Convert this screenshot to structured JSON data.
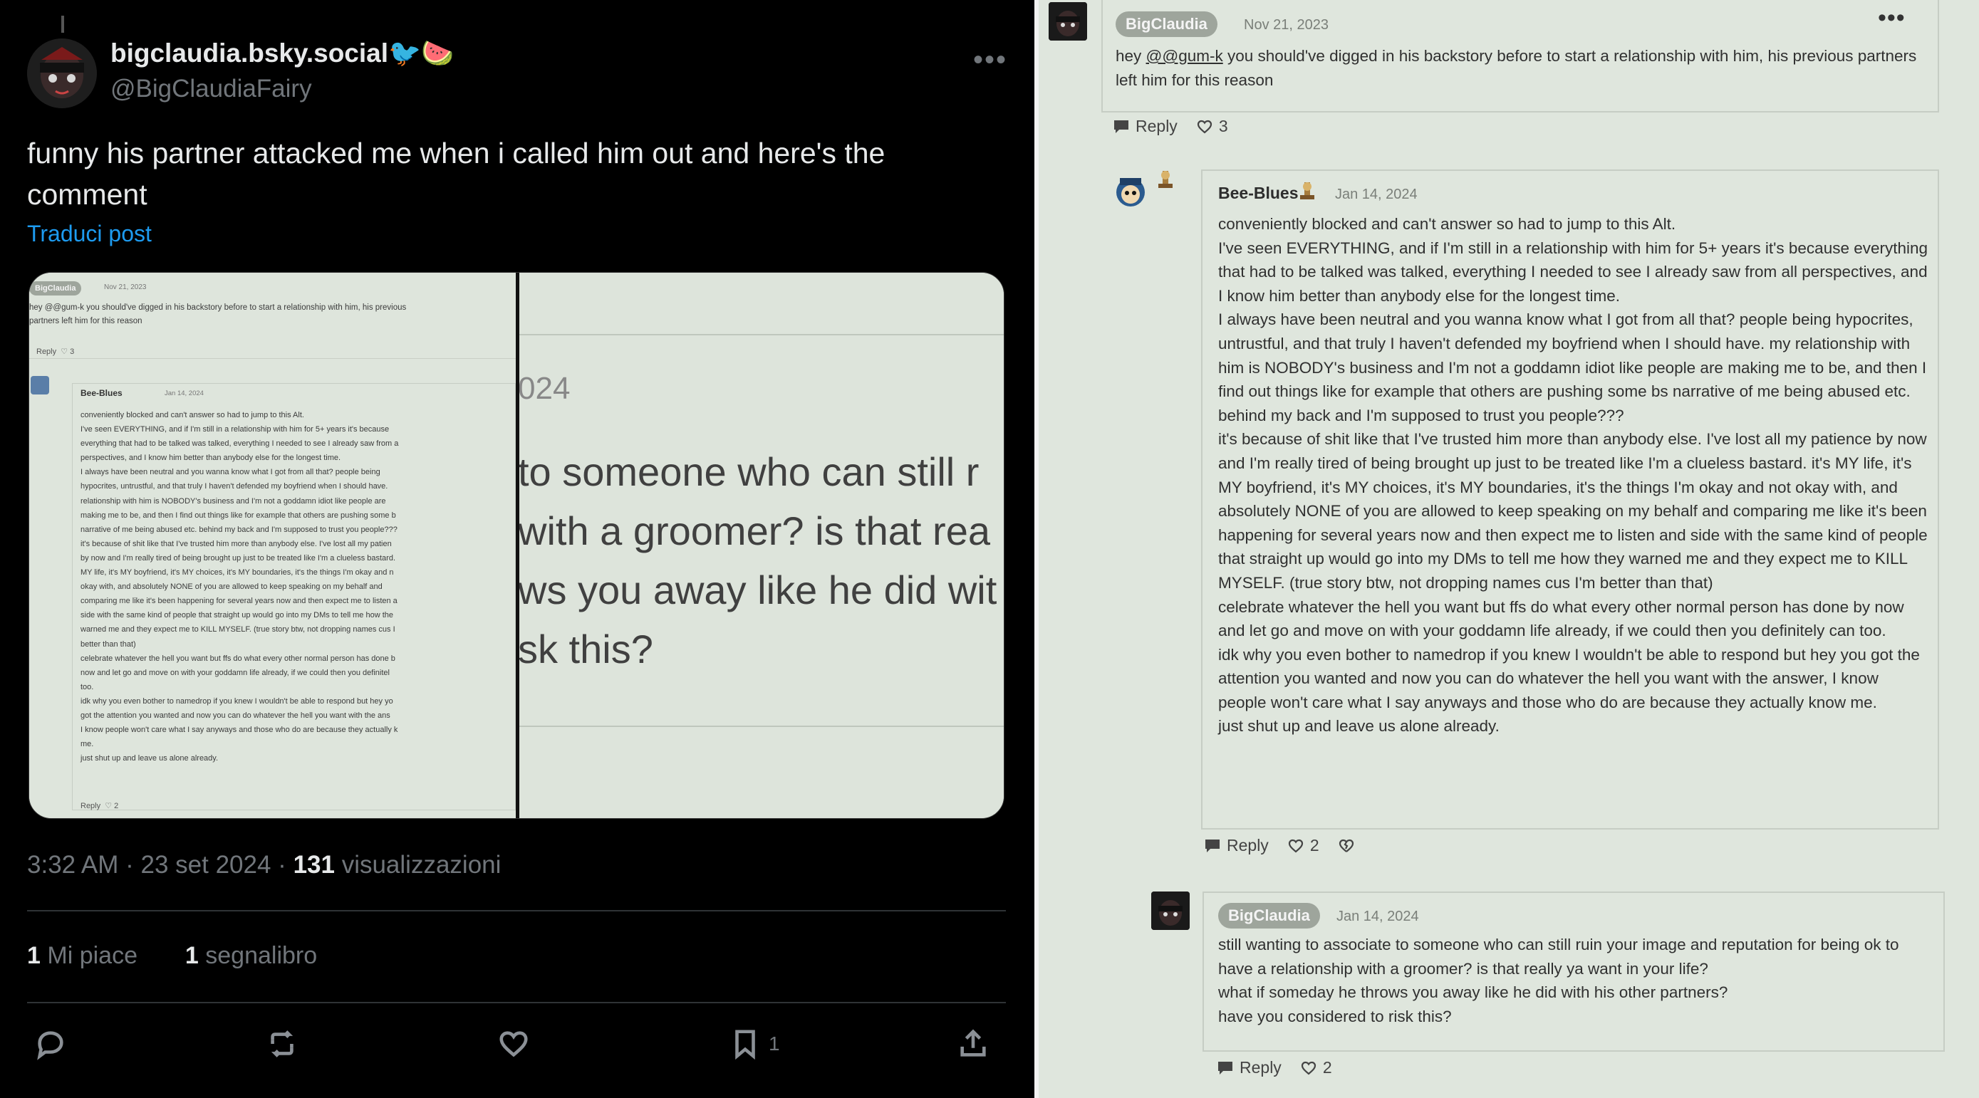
{
  "tweet": {
    "display_name": "bigclaudia.bsky.social🐦🍉",
    "handle": "@BigClaudiaFairy",
    "text": "funny his partner attacked me when i called him out and here's the comment",
    "translate_label": "Traduci post",
    "time": "3:32 AM · 23 set 2024 · ",
    "views_count": "131",
    "views_label": " visualizzazioni",
    "likes_count": "1",
    "likes_label": " Mi piace",
    "bookmarks_count": "1",
    "bookmarks_label": " segnalibro",
    "bookmark_action_count": "1",
    "icons": [
      "more-icon",
      "reply-icon",
      "retweet-icon",
      "like-icon",
      "bookmark-icon",
      "share-icon"
    ],
    "media": {
      "left_panel": {
        "user": "BigClaudia",
        "date": "Nov 21, 2023",
        "comment1_lines": [
          "hey @@gum-k you should've digged in his backstory before to start a relationship with him, his previous",
          "partners left him for this reason"
        ],
        "reply": "Reply",
        "likes": "3",
        "user2": "Bee-Blues",
        "date2": "Jan 14, 2024",
        "comment2_lines": [
          "conveniently blocked and can't answer so had to jump to this Alt.",
          "I've seen EVERYTHING, and if I'm still in a relationship with him for 5+ years it's because",
          "everything that had to be talked was talked, everything I needed to see I already saw from a",
          "perspectives, and I know him better than anybody else for the longest time.",
          "I always have been neutral and you wanna know what I got from all that? people being",
          "hypocrites, untrustful, and that truly I haven't defended my boyfriend when I should have.",
          "relationship with him is NOBODY's business and I'm not a goddamn idiot like people are",
          "making me to be, and then I find out things like for example that others are pushing some b",
          "narrative of me being abused etc. behind my back and I'm supposed to trust you people???",
          "it's because of shit like that I've trusted him more than anybody else. I've lost all my patien",
          "by now and I'm really tired of being brought up just to be treated like I'm a clueless bastard.",
          "MY life, it's MY boyfriend, it's MY choices, it's MY boundaries, it's the things I'm okay and n",
          "okay with, and absolutely NONE of you are allowed to keep speaking on my behalf and",
          "comparing me like it's been happening for several years now and then expect me to listen a",
          "side with the same kind of people that straight up would go into my DMs to tell me how the",
          "warned me and they expect me to KILL MYSELF. (true story btw, not dropping names cus I",
          "better than that)",
          "celebrate whatever the hell you want but ffs do what every other normal person has done b",
          "now and let go and move on with your goddamn life already, if we could then you definitel",
          "too.",
          "idk why you even bother to namedrop if you knew I wouldn't be able to respond but hey yo",
          "got the attention you wanted and now you can do whatever the hell you want with the ans",
          "I know people won't care what I say anyways and those who do are because they actually k",
          "me.",
          "just shut up and leave us alone already."
        ],
        "likes2": "2"
      },
      "right_panel": {
        "date_fragment": "024",
        "lines": [
          "to someone who can still r",
          "with a groomer? is that rea",
          "ws you away like he did wit",
          "sk this?"
        ]
      }
    }
  },
  "thread": {
    "comment1": {
      "user": "BigClaudia",
      "date": "Nov 21, 2023",
      "mention": "@@gum-k",
      "text_before": "hey ",
      "text_after": " you should've digged in his backstory before to start a relationship with him, his previous partners left him for this reason",
      "reply_label": "Reply",
      "likes": "3"
    },
    "comment2": {
      "user": "Bee-Blues",
      "date": "Jan 14, 2024",
      "paragraphs": [
        "conveniently blocked and can't answer so had to jump to this Alt.",
        "I've seen EVERYTHING, and if I'm still in a relationship with him for 5+ years it's because everything that had to be talked was talked, everything I needed to see I already saw from all perspectives, and I know him better than anybody else for the longest time.",
        "I always have been neutral and you wanna know what I got from all that? people being hypocrites, untrustful, and that truly I haven't defended my boyfriend when I should have. my relationship with him is NOBODY's business and I'm not a goddamn idiot like people are making me to be, and then I find out things like for example that others are pushing some bs narrative of me being abused etc. behind my back and I'm supposed to trust you people???",
        "it's because of shit like that I've trusted him more than anybody else. I've lost all my patience by now and I'm really tired of being brought up just to be treated like I'm a clueless bastard. it's MY life, it's MY boyfriend, it's MY choices, it's MY boundaries, it's the things I'm okay and not okay with, and absolutely NONE of you are allowed to keep speaking on my behalf and comparing me like it's been happening for several years now and then expect me to listen and side with the same kind of people that straight up would go into my DMs to tell me how they warned me and they expect me to KILL MYSELF. (true story btw, not dropping names cus I'm better than that)",
        "celebrate whatever the hell you want but ffs do what every other normal person has done by now and let go and move on with your goddamn life already, if we could then you definitely can too.",
        "idk why you even bother to namedrop if you knew I wouldn't be able to respond but hey you got the attention you wanted and now you can do whatever the hell you want with the answer, I know people won't care what I say anyways and those who do are because they actually know me.",
        "just shut up and leave us alone already."
      ],
      "reply_label": "Reply",
      "likes": "2"
    },
    "comment3": {
      "user": "BigClaudia",
      "date": "Jan 14, 2024",
      "paragraphs": [
        "still wanting to associate to someone who can still ruin your image and reputation for being ok to have a relationship with a groomer? is that really ya want in your life?",
        "what if someday he throws you away like he did with his other partners?",
        "have you considered to risk this?"
      ],
      "reply_label": "Reply",
      "likes": "2"
    },
    "colors": {
      "background": "#dfe6dd",
      "pill": "#9ea59c",
      "border": "#c6cdc4",
      "twitter_link": "#1d9bf0"
    }
  }
}
